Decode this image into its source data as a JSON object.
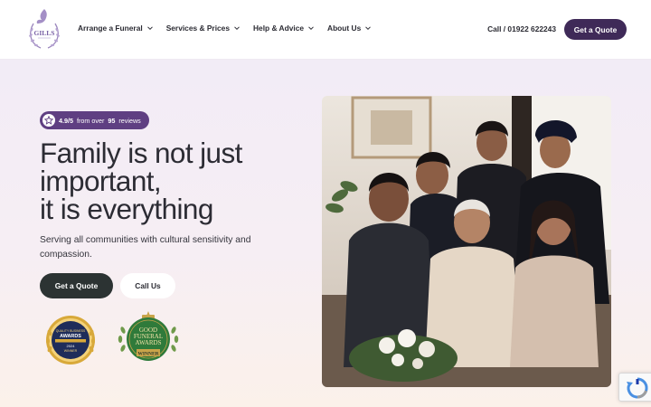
{
  "brand": {
    "logo_text": "GILLS"
  },
  "nav": {
    "items": [
      {
        "label": "Arrange a Funeral"
      },
      {
        "label": "Services & Prices"
      },
      {
        "label": "Help & Advice"
      },
      {
        "label": "About Us"
      }
    ],
    "call_label": "Call / 01922 622243",
    "quote_label": "Get a Quote"
  },
  "hero": {
    "rating": {
      "score": "4.9/5",
      "from_text": "from over",
      "count": "95",
      "reviews_text": "reviews"
    },
    "headline_lines": [
      "Family is not just",
      "important,",
      "it is everything"
    ],
    "subtext": "Serving all communities with cultural sensitivity and compassion.",
    "buttons": {
      "quote": "Get a Quote",
      "call": "Call Us"
    }
  },
  "awards": {
    "first": {
      "line1": "QUALITY BUSINESS",
      "line2": "AWARDS",
      "line3": "2024",
      "line4": "WINNER"
    },
    "second": {
      "line1": "GOOD",
      "line2": "FUNERAL",
      "line3": "AWARDS",
      "line4": "WINNER"
    }
  },
  "colors": {
    "brand_purple": "#3f2a58",
    "rating_purple": "#5f3f82",
    "dark_button": "#2c3333"
  }
}
